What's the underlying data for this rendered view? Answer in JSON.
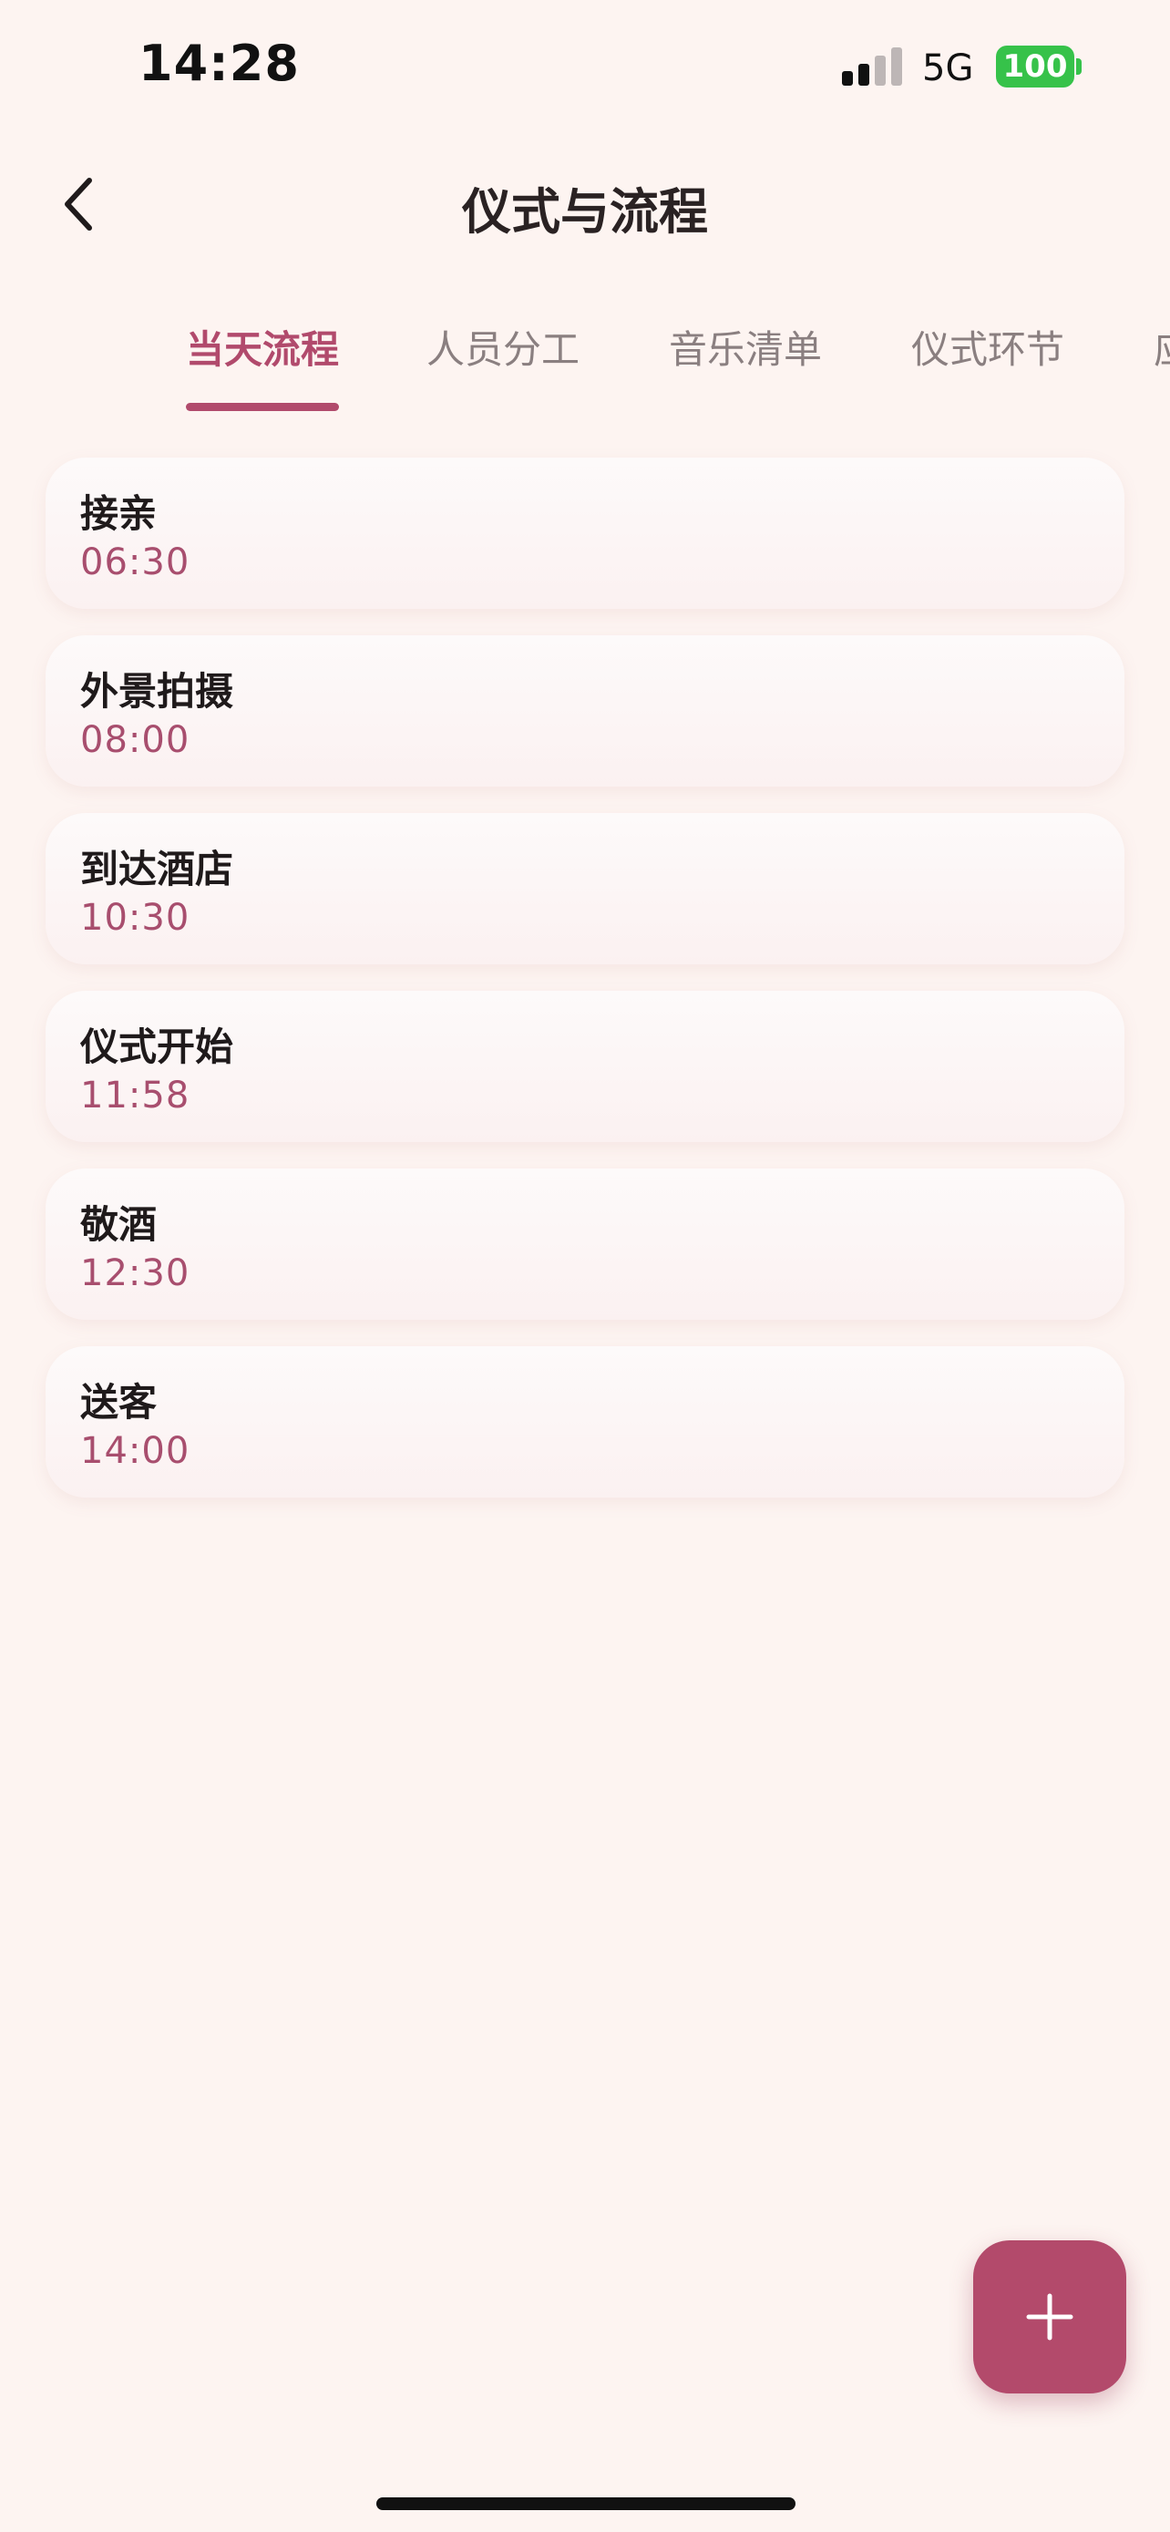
{
  "status_bar": {
    "time": "14:28",
    "network": "5G",
    "battery": "100",
    "battery_color": "#36c24a"
  },
  "header": {
    "back_icon": "chevron-left-icon",
    "title": "仪式与流程"
  },
  "tabs": [
    {
      "label": "当天流程",
      "active": true
    },
    {
      "label": "人员分工",
      "active": false
    },
    {
      "label": "音乐清单",
      "active": false
    },
    {
      "label": "仪式环节",
      "active": false
    },
    {
      "label": "应",
      "active": false
    }
  ],
  "schedule": [
    {
      "title": "接亲",
      "time": "06:30"
    },
    {
      "title": "外景拍摄",
      "time": "08:00"
    },
    {
      "title": "到达酒店",
      "time": "10:30"
    },
    {
      "title": "仪式开始",
      "time": "11:58"
    },
    {
      "title": "敬酒",
      "time": "12:30"
    },
    {
      "title": "送客",
      "time": "14:00"
    }
  ],
  "fab": {
    "icon": "plus-icon"
  },
  "colors": {
    "accent": "#b14a6c",
    "background": "#fdf4f1",
    "time_text": "#a84e6e"
  }
}
